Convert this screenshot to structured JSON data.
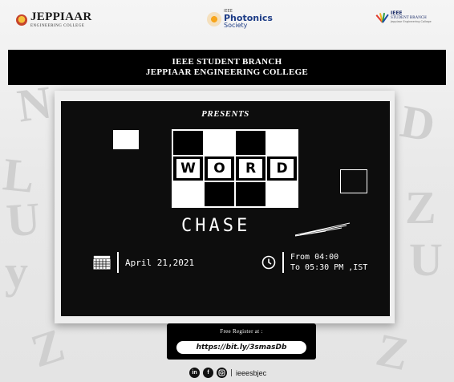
{
  "logos": {
    "jeppiaar_name": "JEPPIAAR",
    "jeppiaar_sub": "ENGINEERING COLLEGE",
    "photonics_ieee": "IEEE",
    "photonics_name": "Photonics",
    "photonics_society": "Society",
    "sb_ieee": "IEEE",
    "sb_name": "STUDENT BRANCH",
    "sb_sub": "Jeppiaar Engineering College"
  },
  "header": {
    "line1": "IEEE STUDENT BRANCH",
    "line2": "JEPPIAAR ENGINEERING COLLEGE"
  },
  "event": {
    "presents": "PRESENTS",
    "word_letters": [
      "W",
      "O",
      "R",
      "D"
    ],
    "chase": "CHASE",
    "date": "April 21,2021",
    "time_line1": "From 04:00",
    "time_line2": "To 05:30 PM ,IST"
  },
  "registration": {
    "label": "Free Register at :",
    "link": "https://bit.ly/3smasDb"
  },
  "social": {
    "icons": [
      "linkedin-icon",
      "facebook-icon",
      "instagram-icon"
    ],
    "separator": "|",
    "handle": "ieeesbjec"
  },
  "colors": {
    "board": "#0d0d0d",
    "header_band": "#000000",
    "photonics_blue": "#1d3c86",
    "photonics_orange": "#f7a51b"
  }
}
